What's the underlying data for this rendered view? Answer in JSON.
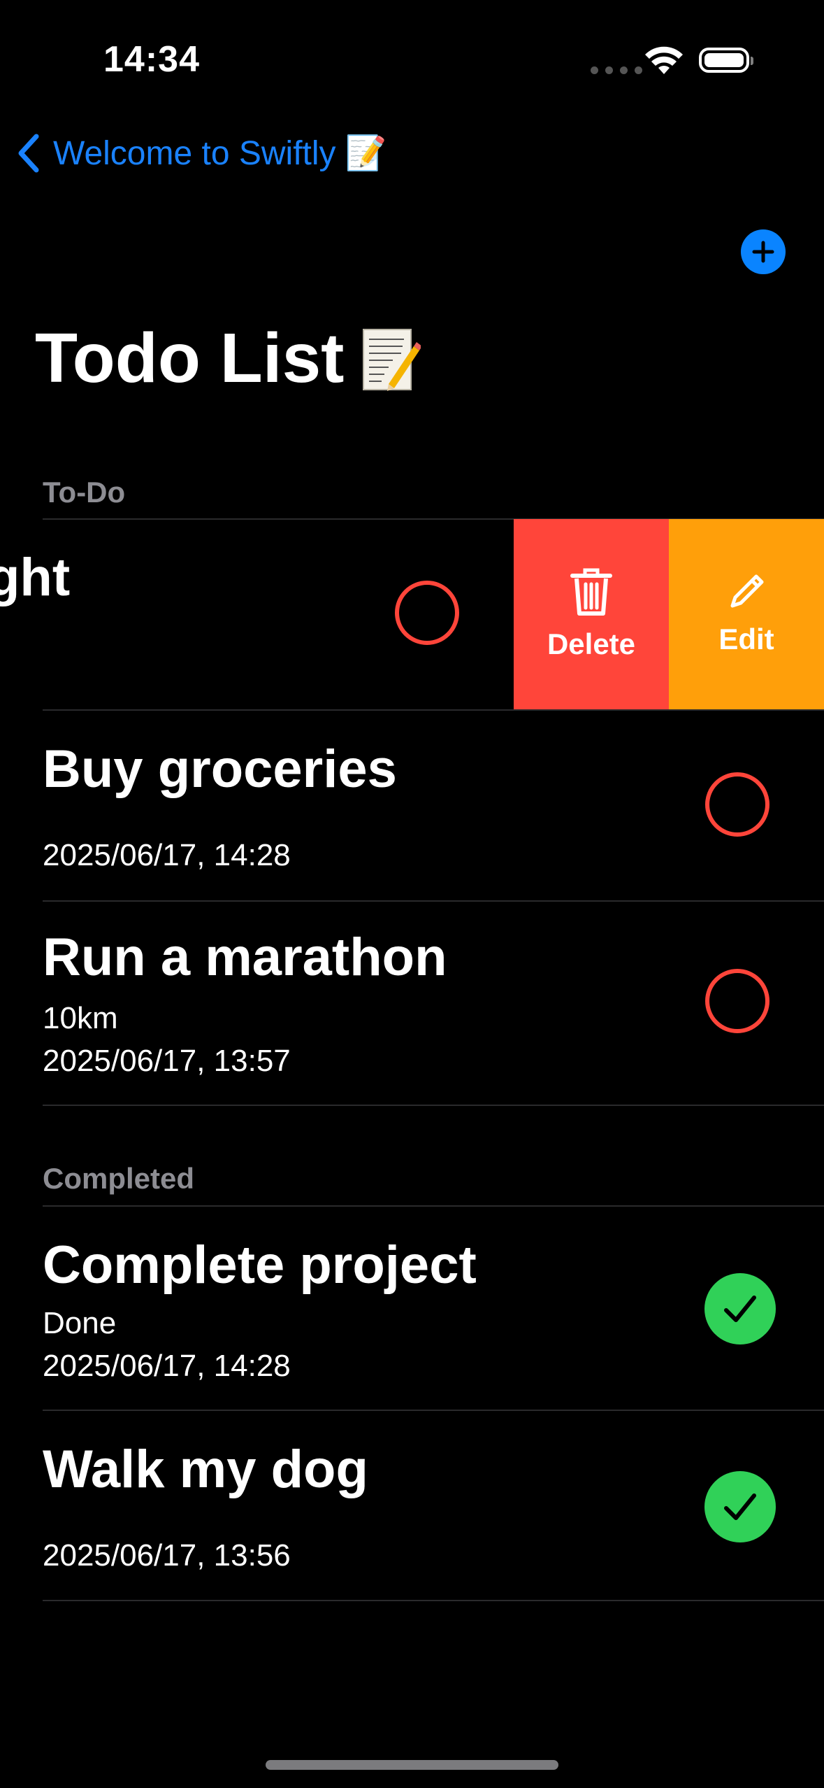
{
  "status_bar": {
    "time": "14:34"
  },
  "nav": {
    "back_label": "Welcome to Swiftly 📝",
    "add_button": "plus-icon"
  },
  "page": {
    "title": "Todo List"
  },
  "sections": {
    "todo": {
      "header": "To-Do"
    },
    "completed": {
      "header": "Completed"
    }
  },
  "swiped_row": {
    "title_fragment": "ght",
    "subtitle_fragment": ")"
  },
  "swipe_actions": {
    "delete_label": "Delete",
    "edit_label": "Edit"
  },
  "todo_items": [
    {
      "title": "Buy groceries",
      "note": "",
      "date": "2025/06/17, 14:28",
      "done": false
    },
    {
      "title": "Run a marathon",
      "note": "10km",
      "date": "2025/06/17, 13:57",
      "done": false
    }
  ],
  "completed_items": [
    {
      "title": "Complete project",
      "note": "Done",
      "date": "2025/06/17, 14:28",
      "done": true
    },
    {
      "title": "Walk my dog",
      "note": "",
      "date": "2025/06/17, 13:56",
      "done": true
    }
  ],
  "colors": {
    "accent": "#0a84ff",
    "delete": "#ff453a",
    "edit": "#ff9f0a",
    "done": "#30d158",
    "pending_ring": "#ff453a"
  }
}
